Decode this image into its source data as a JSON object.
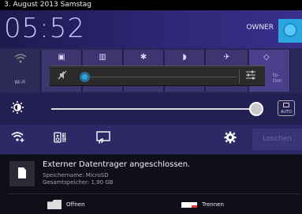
{
  "status_bar": {
    "date": "3. August 2013 Samstag"
  },
  "header": {
    "time": "05:52",
    "owner_label": "OWNER"
  },
  "quick_tiles": [
    {
      "label": "Wi-Fi",
      "icon": "wifi-icon"
    },
    {
      "label": "",
      "icon": "rotate-icon"
    },
    {
      "label": "",
      "icon": "grid-icon"
    },
    {
      "label": "",
      "icon": "bluetooth-icon"
    },
    {
      "label": "",
      "icon": "cast-icon"
    },
    {
      "label": "",
      "icon": "airplane-icon"
    },
    {
      "label": "to-\ntion",
      "icon": "location-icon"
    }
  ],
  "volume_popup": {
    "icon": "mute-icon",
    "settings_icon": "equalizer-icon",
    "level": 0
  },
  "brightness": {
    "icon": "brightness-icon",
    "auto_label": "AUTO",
    "level": 0.98
  },
  "actions": {
    "loeschen_label": "Loschen"
  },
  "notification": {
    "title": "Externer Datentrager angeschlossen.",
    "line1": "Speichername: MicroSD",
    "line2": "Gesamtspeicher: 1,90 GB",
    "open_label": "Offnen",
    "disconnect_label": "Trennen"
  },
  "colors": {
    "accent": "#2aa6e0",
    "header_bg": "#2c2470"
  }
}
